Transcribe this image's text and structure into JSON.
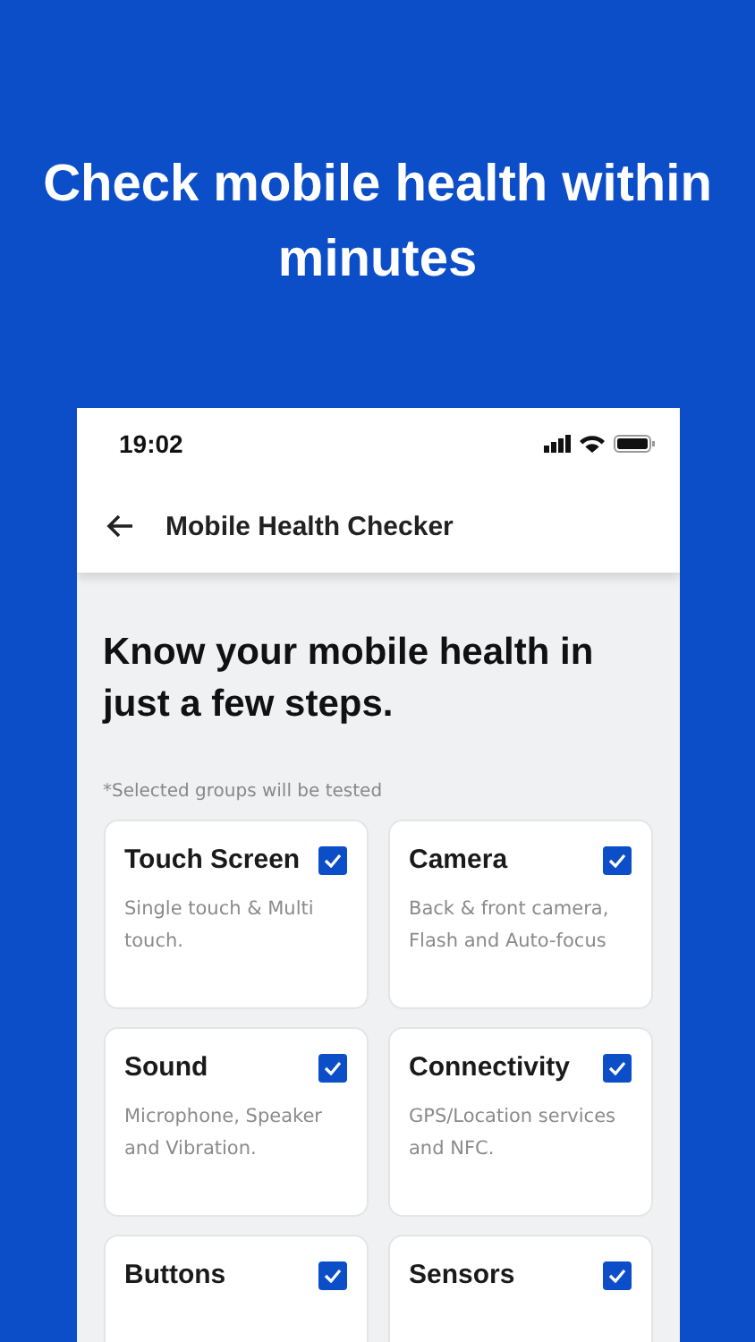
{
  "headline": "Check mobile health within minutes",
  "status_bar": {
    "time": "19:02"
  },
  "app_bar": {
    "title": "Mobile Health Checker"
  },
  "heading": "Know your mobile health in just a few steps.",
  "note": "*Selected groups will be tested",
  "groups": [
    {
      "title": "Touch Screen",
      "description": "Single touch & Multi touch.",
      "checked": true
    },
    {
      "title": "Camera",
      "description": "Back & front camera, Flash and Auto-focus",
      "checked": true
    },
    {
      "title": "Sound",
      "description": "Microphone, Speaker and Vibration.",
      "checked": true
    },
    {
      "title": "Connectivity",
      "description": "GPS/Location services and NFC.",
      "checked": true
    },
    {
      "title": "Buttons",
      "checked": true
    },
    {
      "title": "Sensors",
      "checked": true
    }
  ]
}
